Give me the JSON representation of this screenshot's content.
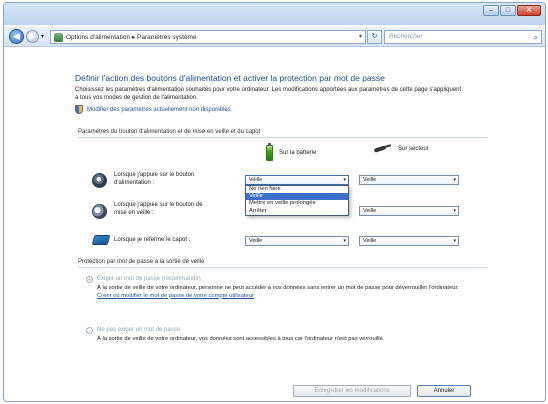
{
  "window": {
    "buttons": {
      "minimize": "–",
      "maximize": "□",
      "close": "✕"
    }
  },
  "nav": {
    "back": "◀",
    "forward": "▶",
    "history": "▾",
    "address": "Options d'alimentation  ▸  Paramètres système",
    "refresh": "↻",
    "search_placeholder": "Rechercher",
    "search_icon": "⌕"
  },
  "page": {
    "title": "Définir l'action des boutons d'alimentation et activer la protection par mot de passe",
    "intro": "Choisissez les paramètres d'alimentation souhaités pour votre ordinateur. Les modifications apportées aux paramètres de cette page s'appliquent à tous vos modes de gestion de l'alimentation.",
    "change_link": "Modifier des paramètres actuellement non disponibles"
  },
  "power_buttons": {
    "section_title": "Paramètres du bouton d'alimentation et de mise en veille et du capot",
    "col_battery": "Sur la batterie",
    "col_ac": "Sur secteur",
    "rows": [
      {
        "label_1": "Lorsque j'appuie sur le bouton",
        "label_2": "d'alimentation :",
        "battery": "Veille",
        "ac": "Veille"
      },
      {
        "label_1": "Lorsque j'appuie sur le bouton de",
        "label_2": "mise en veille :",
        "battery": "Veille",
        "ac": "Veille"
      },
      {
        "label_1": "Lorsque je referme le capot :",
        "label_2": "",
        "battery": "Veille",
        "ac": "Veille"
      }
    ],
    "dropdown_options": [
      "Ne rien faire",
      "Veille",
      "Mettre en veille prolongée",
      "Arrêter"
    ],
    "dropdown_selected": "Veille",
    "select_arrow": "▾"
  },
  "password": {
    "section_title": "Protection par mot de passe à la sortie de veille",
    "option1_title": "Exiger un mot de passe (recommandé)",
    "option1_desc_a": "À la sortie de veille de votre ordinateur, personne ne peut accéder à vos données sans entrer un mot de passe pour déverrouiller l'ordinateur.",
    "option1_link": "Créer ou modifier le mot de passe de votre compte utilisateur",
    "option2_title": "Ne pas exiger un mot de passe",
    "option2_desc": "À la sortie de veille de votre ordinateur, vos données sont accessibles à tous car l'ordinateur n'est pas verrouillé."
  },
  "footer": {
    "save": "Enregistrer les modifications",
    "cancel": "Annuler"
  }
}
